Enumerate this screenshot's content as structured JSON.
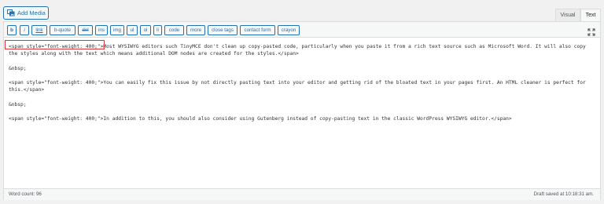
{
  "media": {
    "add_media_label": "Add Media",
    "icon": "media-icon"
  },
  "tabs": {
    "visual": "Visual",
    "text": "Text"
  },
  "toolbar": {
    "buttons": [
      "b",
      "i",
      "link",
      "b-quote",
      "del",
      "ins",
      "img",
      "ul",
      "ol",
      "li",
      "code",
      "more",
      "close tags",
      "contact form",
      "crayon"
    ]
  },
  "content": {
    "paragraphs": [
      "<span style=\"font-weight: 400;\">Most WYSIWYG editors such TinyMCE don't clean up copy-pasted code, particularly when you paste it from a rich text source such as Microsoft Word. It will also copy the styles along with the text which means additional DOM nodes are created for the styles.</span>",
      "&nbsp;",
      "<span style=\"font-weight: 400;\">You can easily fix this issue by not directly pasting text into your editor and getting rid of the bloated text in your pages first. An HTML cleaner is perfect for this.</span>",
      "&nbsp;",
      "<span style=\"font-weight: 400;\">In addition to this, you should also consider using Gutenberg instead of copy-pasting text in the classic WordPress WYSIWYG editor.</span>"
    ]
  },
  "status": {
    "word_count": "Word count: 96",
    "draft_saved": "Draft saved at 10:18:31 am."
  },
  "colors": {
    "accent": "#2271b1",
    "highlight": "#d63638"
  }
}
